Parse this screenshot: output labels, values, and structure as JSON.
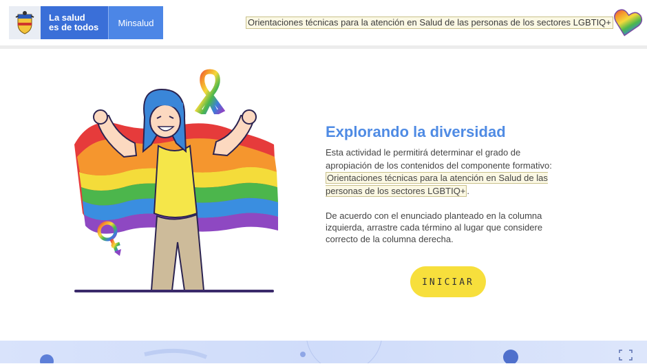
{
  "header": {
    "logo_line1": "La salud",
    "logo_line2": "es de todos",
    "logo_org": "Minsalud",
    "title": "Orientaciones técnicas para la atención en Salud de las personas de los sectores LGBTIQ+"
  },
  "main": {
    "heading": "Explorando la diversidad",
    "desc_line1": "Esta actividad le permitirá determinar el grado de apropiación de los contenidos del componente formativo:",
    "desc_highlight": "Orientaciones técnicas para la atención en Salud de las personas de los sectores LGBTIQ+",
    "desc_end": ".",
    "instructions": "De acuerdo con el enunciado planteado en la columna izquierda, arrastre cada término al lugar que considere correcto de la columna derecha.",
    "start_label": "INICIAR"
  },
  "icons": {
    "logo": "colombia-coat-of-arms-icon",
    "heart": "rainbow-heart-icon",
    "ribbon": "rainbow-ribbon-icon",
    "gender": "female-symbol-icon",
    "fullscreen": "fullscreen-icon"
  },
  "colors": {
    "accent": "#4f8be4",
    "button": "#f7df3c",
    "logo_blue": "#3a6fd8",
    "highlight_bg": "#fbf8e4"
  }
}
